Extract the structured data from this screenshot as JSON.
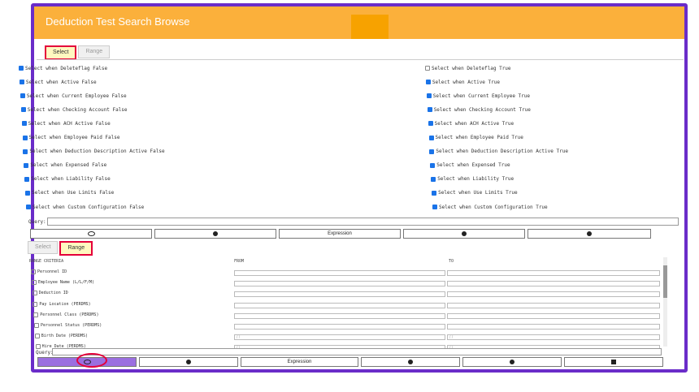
{
  "window": {
    "title": "Deduction Test Search Browse"
  },
  "upper": {
    "tabs": [
      "Select",
      "Range"
    ],
    "left_checks": [
      {
        "label": "Select when Deleteflag False",
        "checked": true
      },
      {
        "label": "Select when Active False",
        "checked": true
      },
      {
        "label": "Select when Current Employee False",
        "checked": true
      },
      {
        "label": "Select when Checking Account False",
        "checked": true
      },
      {
        "label": "Select when ACH Active False",
        "checked": true
      },
      {
        "label": "Select when Employee Paid False",
        "checked": true
      },
      {
        "label": "Select when Deduction Description Active False",
        "checked": true
      },
      {
        "label": "Select when Expensed False",
        "checked": true
      },
      {
        "label": "Select when Liability False",
        "checked": true
      },
      {
        "label": "Select when Use Limits False",
        "checked": true
      },
      {
        "label": "Select when Custom Configuration False",
        "checked": true
      }
    ],
    "right_checks": [
      {
        "label": "Select when Deleteflag True",
        "checked": false
      },
      {
        "label": "Select when Active True",
        "checked": true
      },
      {
        "label": "Select when Current Employee True",
        "checked": true
      },
      {
        "label": "Select when Checking Account True",
        "checked": true
      },
      {
        "label": "Select when ACH Active True",
        "checked": true
      },
      {
        "label": "Select when Employee Paid True",
        "checked": true
      },
      {
        "label": "Select when Deduction Description Active True",
        "checked": true
      },
      {
        "label": "Select when Expensed True",
        "checked": true
      },
      {
        "label": "Select when Liability True",
        "checked": true
      },
      {
        "label": "Select when Use Limits True",
        "checked": true
      },
      {
        "label": "Select when Custom Configuration True",
        "checked": true
      }
    ],
    "query_label": "Query:",
    "buttons": [
      "view-icon",
      "close-icon",
      "Expression",
      "help-icon",
      "check-icon"
    ]
  },
  "lower": {
    "tabs": [
      "Select",
      "Range"
    ],
    "headers": {
      "criteria": "RANGE CRITERIA",
      "from": "FROM",
      "to": "TO"
    },
    "rows": [
      {
        "label": "Personnel ID",
        "from": "",
        "to": ""
      },
      {
        "label": "Employee Name (L/L/F/M)",
        "from": "",
        "to": ""
      },
      {
        "label": "Deduction ID",
        "from": "",
        "to": ""
      },
      {
        "label": "Pay Location (PERDMS)",
        "from": "",
        "to": ""
      },
      {
        "label": "Personnel Class (PERDMS)",
        "from": "",
        "to": ""
      },
      {
        "label": "Personnel Status (PERDMS)",
        "from": "",
        "to": ""
      },
      {
        "label": "Birth Date (PERDMS)",
        "from": " /  /",
        "to": " /  /"
      },
      {
        "label": "Hire Date (PERDMS)",
        "from": " /  /",
        "to": " /  /"
      }
    ],
    "query_label": "Query:",
    "buttons": [
      "view-icon",
      "close-icon",
      "Expression",
      "help-icon",
      "check-icon",
      "export-icon"
    ]
  },
  "colors": {
    "titlebar": "#fbb03b",
    "frame": "#6a2cc9",
    "active_button": "#9b6fe0"
  }
}
